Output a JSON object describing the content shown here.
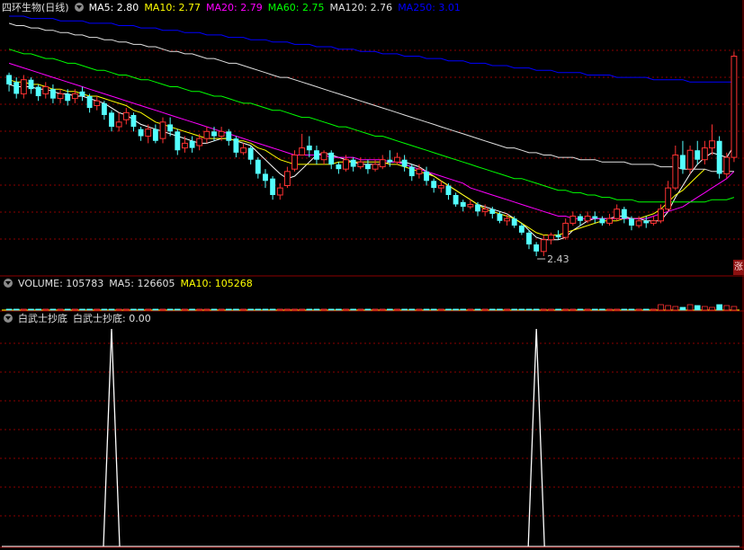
{
  "header_main": {
    "title": "四环生物(日线)",
    "ma5": "MA5: 2.80",
    "ma10": "MA10: 2.77",
    "ma20": "MA20: 2.79",
    "ma60": "MA60: 2.75",
    "ma120": "MA120: 2.76",
    "ma250": "MA250: 3.01"
  },
  "header_volume": {
    "volume": "VOLUME: 105783",
    "ma5": "MA5: 126605",
    "ma10": "MA10: 105268"
  },
  "header_indicator": {
    "name": "白武士抄底",
    "value": "白武士抄底: 0.00"
  },
  "low_marker": "2.43",
  "side_badge": "涨",
  "colors": {
    "up": "#ff3232",
    "down": "#54ffff",
    "ma5": "#ffffff",
    "ma10": "#ffff00",
    "ma20": "#ff00ff",
    "ma60": "#00ff00",
    "ma120": "#e0e0e0",
    "ma250": "#0000ff",
    "grid": "#8b0000"
  },
  "chart_data": [
    {
      "type": "candlestick",
      "title": "四环生物(日线)",
      "ylim": [
        2.35,
        3.45
      ],
      "candles": [
        [
          3.2,
          3.16,
          3.21,
          3.13
        ],
        [
          3.17,
          3.12,
          3.19,
          3.1
        ],
        [
          3.12,
          3.18,
          3.2,
          3.1
        ],
        [
          3.18,
          3.14,
          3.19,
          3.12
        ],
        [
          3.15,
          3.11,
          3.16,
          3.09
        ],
        [
          3.12,
          3.15,
          3.17,
          3.1
        ],
        [
          3.14,
          3.1,
          3.16,
          3.08
        ],
        [
          3.1,
          3.12,
          3.14,
          3.08
        ],
        [
          3.12,
          3.09,
          3.14,
          3.07
        ],
        [
          3.1,
          3.12,
          3.14,
          3.08
        ],
        [
          3.13,
          3.11,
          3.15,
          3.09
        ],
        [
          3.11,
          3.06,
          3.12,
          3.04
        ],
        [
          3.07,
          3.09,
          3.11,
          3.05
        ],
        [
          3.08,
          3.03,
          3.09,
          3.01
        ],
        [
          3.04,
          2.98,
          3.05,
          2.96
        ],
        [
          2.98,
          3.0,
          3.04,
          2.96
        ],
        [
          3.01,
          3.04,
          3.06,
          2.99
        ],
        [
          3.03,
          2.98,
          3.04,
          2.96
        ],
        [
          2.97,
          2.94,
          2.98,
          2.92
        ],
        [
          2.94,
          2.97,
          2.99,
          2.91
        ],
        [
          2.97,
          2.92,
          2.99,
          2.91
        ],
        [
          2.93,
          3.0,
          3.02,
          2.91
        ],
        [
          2.99,
          2.96,
          3.02,
          2.94
        ],
        [
          2.96,
          2.88,
          2.97,
          2.86
        ],
        [
          2.89,
          2.91,
          2.94,
          2.87
        ],
        [
          2.92,
          2.89,
          2.94,
          2.87
        ],
        [
          2.9,
          2.93,
          2.95,
          2.88
        ],
        [
          2.93,
          2.96,
          2.98,
          2.91
        ],
        [
          2.96,
          2.94,
          2.98,
          2.92
        ],
        [
          2.94,
          2.96,
          2.98,
          2.92
        ],
        [
          2.96,
          2.92,
          2.97,
          2.9
        ],
        [
          2.93,
          2.87,
          2.94,
          2.85
        ],
        [
          2.87,
          2.89,
          2.91,
          2.86
        ],
        [
          2.89,
          2.84,
          2.9,
          2.82
        ],
        [
          2.84,
          2.78,
          2.85,
          2.76
        ],
        [
          2.78,
          2.75,
          2.8,
          2.72
        ],
        [
          2.76,
          2.69,
          2.77,
          2.67
        ],
        [
          2.69,
          2.72,
          2.74,
          2.67
        ],
        [
          2.73,
          2.79,
          2.81,
          2.72
        ],
        [
          2.8,
          2.86,
          2.88,
          2.79
        ],
        [
          2.86,
          2.89,
          2.95,
          2.86
        ],
        [
          2.9,
          2.88,
          2.94,
          2.85
        ],
        [
          2.88,
          2.84,
          2.9,
          2.82
        ],
        [
          2.84,
          2.87,
          2.88,
          2.82
        ],
        [
          2.87,
          2.82,
          2.88,
          2.8
        ],
        [
          2.82,
          2.8,
          2.83,
          2.78
        ],
        [
          2.8,
          2.84,
          2.86,
          2.79
        ],
        [
          2.84,
          2.81,
          2.85,
          2.79
        ],
        [
          2.81,
          2.83,
          2.85,
          2.8
        ],
        [
          2.82,
          2.8,
          2.84,
          2.78
        ],
        [
          2.8,
          2.82,
          2.84,
          2.79
        ],
        [
          2.81,
          2.84,
          2.86,
          2.8
        ],
        [
          2.84,
          2.83,
          2.88,
          2.81
        ],
        [
          2.83,
          2.85,
          2.87,
          2.82
        ],
        [
          2.84,
          2.81,
          2.86,
          2.79
        ],
        [
          2.81,
          2.77,
          2.82,
          2.75
        ],
        [
          2.78,
          2.8,
          2.82,
          2.76
        ],
        [
          2.79,
          2.75,
          2.81,
          2.73
        ],
        [
          2.75,
          2.72,
          2.76,
          2.7
        ],
        [
          2.72,
          2.73,
          2.75,
          2.7
        ],
        [
          2.73,
          2.69,
          2.74,
          2.67
        ],
        [
          2.69,
          2.65,
          2.7,
          2.64
        ],
        [
          2.66,
          2.64,
          2.67,
          2.62
        ],
        [
          2.64,
          2.65,
          2.67,
          2.63
        ],
        [
          2.65,
          2.62,
          2.66,
          2.6
        ],
        [
          2.62,
          2.63,
          2.65,
          2.6
        ],
        [
          2.63,
          2.61,
          2.64,
          2.59
        ],
        [
          2.61,
          2.58,
          2.62,
          2.57
        ],
        [
          2.58,
          2.59,
          2.61,
          2.56
        ],
        [
          2.59,
          2.56,
          2.6,
          2.55
        ],
        [
          2.56,
          2.53,
          2.57,
          2.52
        ],
        [
          2.53,
          2.48,
          2.54,
          2.46
        ],
        [
          2.48,
          2.45,
          2.49,
          2.43
        ],
        [
          2.45,
          2.5,
          2.52,
          2.43
        ],
        [
          2.5,
          2.52,
          2.53,
          2.48
        ],
        [
          2.52,
          2.51,
          2.54,
          2.5
        ],
        [
          2.51,
          2.57,
          2.59,
          2.5
        ],
        [
          2.57,
          2.6,
          2.62,
          2.56
        ],
        [
          2.6,
          2.58,
          2.61,
          2.56
        ],
        [
          2.58,
          2.6,
          2.62,
          2.57
        ],
        [
          2.6,
          2.59,
          2.62,
          2.57
        ],
        [
          2.59,
          2.57,
          2.6,
          2.56
        ],
        [
          2.57,
          2.59,
          2.61,
          2.56
        ],
        [
          2.59,
          2.63,
          2.65,
          2.58
        ],
        [
          2.63,
          2.59,
          2.64,
          2.57
        ],
        [
          2.59,
          2.56,
          2.6,
          2.54
        ],
        [
          2.56,
          2.58,
          2.6,
          2.55
        ],
        [
          2.58,
          2.57,
          2.6,
          2.55
        ],
        [
          2.57,
          2.58,
          2.6,
          2.56
        ],
        [
          2.58,
          2.63,
          2.65,
          2.57
        ],
        [
          2.63,
          2.72,
          2.75,
          2.62
        ],
        [
          2.72,
          2.86,
          2.9,
          2.71
        ],
        [
          2.86,
          2.8,
          2.92,
          2.78
        ],
        [
          2.8,
          2.88,
          2.9,
          2.78
        ],
        [
          2.88,
          2.84,
          2.92,
          2.82
        ],
        [
          2.84,
          2.89,
          2.92,
          2.82
        ],
        [
          2.89,
          2.92,
          2.99,
          2.86
        ],
        [
          2.92,
          2.78,
          2.94,
          2.76
        ],
        [
          2.78,
          2.85,
          2.87,
          2.76
        ],
        [
          2.85,
          3.28,
          3.3,
          2.83
        ]
      ],
      "ma": {
        "MA5": [
          3.16,
          3.15,
          3.15,
          3.15,
          3.14,
          3.14,
          3.13,
          3.12,
          3.12,
          3.11,
          3.11,
          3.1,
          3.09,
          3.08,
          3.06,
          3.04,
          3.03,
          3.01,
          2.99,
          2.98,
          2.97,
          2.96,
          2.95,
          2.94,
          2.93,
          2.92,
          2.91,
          2.91,
          2.92,
          2.93,
          2.93,
          2.92,
          2.91,
          2.9,
          2.87,
          2.84,
          2.81,
          2.78,
          2.76,
          2.77,
          2.8,
          2.83,
          2.86,
          2.87,
          2.86,
          2.85,
          2.84,
          2.83,
          2.82,
          2.82,
          2.82,
          2.82,
          2.83,
          2.83,
          2.83,
          2.82,
          2.81,
          2.79,
          2.77,
          2.75,
          2.73,
          2.71,
          2.69,
          2.67,
          2.65,
          2.64,
          2.63,
          2.62,
          2.61,
          2.59,
          2.57,
          2.54,
          2.51,
          2.5,
          2.5,
          2.5,
          2.51,
          2.54,
          2.56,
          2.58,
          2.59,
          2.59,
          2.59,
          2.6,
          2.6,
          2.59,
          2.59,
          2.58,
          2.58,
          2.58,
          2.62,
          2.68,
          2.73,
          2.78,
          2.82,
          2.85,
          2.87,
          2.86,
          2.85,
          2.9
        ],
        "MA10": [
          3.18,
          3.17,
          3.17,
          3.16,
          3.16,
          3.15,
          3.14,
          3.14,
          3.13,
          3.13,
          3.12,
          3.11,
          3.11,
          3.1,
          3.09,
          3.08,
          3.07,
          3.05,
          3.04,
          3.02,
          3.0,
          2.99,
          2.98,
          2.97,
          2.96,
          2.95,
          2.94,
          2.93,
          2.93,
          2.93,
          2.93,
          2.92,
          2.92,
          2.91,
          2.89,
          2.88,
          2.86,
          2.84,
          2.83,
          2.82,
          2.82,
          2.82,
          2.82,
          2.82,
          2.82,
          2.83,
          2.83,
          2.83,
          2.83,
          2.83,
          2.83,
          2.83,
          2.82,
          2.82,
          2.81,
          2.8,
          2.79,
          2.78,
          2.77,
          2.75,
          2.73,
          2.71,
          2.69,
          2.67,
          2.65,
          2.63,
          2.62,
          2.61,
          2.6,
          2.59,
          2.57,
          2.55,
          2.53,
          2.52,
          2.52,
          2.52,
          2.53,
          2.54,
          2.55,
          2.56,
          2.57,
          2.58,
          2.58,
          2.58,
          2.59,
          2.59,
          2.59,
          2.6,
          2.61,
          2.63,
          2.66,
          2.69,
          2.71,
          2.74,
          2.77,
          2.8
        ],
        "MA20": [
          3.25,
          3.24,
          3.23,
          3.22,
          3.21,
          3.2,
          3.19,
          3.18,
          3.17,
          3.16,
          3.15,
          3.14,
          3.13,
          3.12,
          3.11,
          3.1,
          3.09,
          3.08,
          3.07,
          3.06,
          3.05,
          3.04,
          3.03,
          3.02,
          3.01,
          3.0,
          2.99,
          2.98,
          2.97,
          2.96,
          2.95,
          2.94,
          2.93,
          2.92,
          2.91,
          2.9,
          2.89,
          2.88,
          2.87,
          2.86,
          2.86,
          2.86,
          2.86,
          2.86,
          2.85,
          2.85,
          2.85,
          2.85,
          2.84,
          2.84,
          2.84,
          2.84,
          2.83,
          2.83,
          2.82,
          2.81,
          2.8,
          2.79,
          2.78,
          2.77,
          2.76,
          2.75,
          2.74,
          2.72,
          2.71,
          2.7,
          2.69,
          2.68,
          2.67,
          2.66,
          2.65,
          2.64,
          2.63,
          2.62,
          2.61,
          2.6,
          2.6,
          2.59,
          2.59,
          2.59,
          2.59,
          2.59,
          2.59,
          2.59,
          2.59,
          2.59,
          2.59,
          2.59,
          2.6,
          2.61,
          2.62,
          2.63,
          2.64,
          2.66,
          2.68,
          2.7,
          2.72,
          2.74,
          2.76,
          2.79
        ],
        "MA60": [
          3.31,
          3.3,
          3.29,
          3.29,
          3.28,
          3.27,
          3.27,
          3.26,
          3.25,
          3.25,
          3.24,
          3.23,
          3.22,
          3.22,
          3.21,
          3.2,
          3.2,
          3.19,
          3.18,
          3.18,
          3.17,
          3.16,
          3.15,
          3.15,
          3.14,
          3.13,
          3.13,
          3.12,
          3.11,
          3.11,
          3.1,
          3.09,
          3.08,
          3.08,
          3.07,
          3.06,
          3.05,
          3.05,
          3.04,
          3.03,
          3.02,
          3.02,
          3.01,
          3.0,
          2.99,
          2.98,
          2.98,
          2.97,
          2.96,
          2.95,
          2.94,
          2.94,
          2.93,
          2.92,
          2.91,
          2.9,
          2.89,
          2.88,
          2.87,
          2.86,
          2.85,
          2.84,
          2.83,
          2.82,
          2.81,
          2.8,
          2.79,
          2.78,
          2.77,
          2.76,
          2.76,
          2.75,
          2.74,
          2.73,
          2.72,
          2.71,
          2.71,
          2.7,
          2.7,
          2.69,
          2.69,
          2.68,
          2.68,
          2.67,
          2.67,
          2.67,
          2.66,
          2.66,
          2.66,
          2.66,
          2.66,
          2.66,
          2.66,
          2.66,
          2.66,
          2.66,
          2.67,
          2.67,
          2.67,
          2.68
        ],
        "MA120": [
          3.42,
          3.41,
          3.41,
          3.4,
          3.4,
          3.39,
          3.39,
          3.38,
          3.38,
          3.37,
          3.37,
          3.36,
          3.36,
          3.35,
          3.35,
          3.34,
          3.34,
          3.33,
          3.33,
          3.32,
          3.32,
          3.31,
          3.3,
          3.3,
          3.29,
          3.29,
          3.28,
          3.27,
          3.27,
          3.26,
          3.25,
          3.25,
          3.24,
          3.23,
          3.22,
          3.21,
          3.2,
          3.19,
          3.19,
          3.18,
          3.17,
          3.16,
          3.15,
          3.14,
          3.13,
          3.12,
          3.11,
          3.1,
          3.09,
          3.08,
          3.07,
          3.06,
          3.05,
          3.04,
          3.03,
          3.02,
          3.01,
          3.0,
          2.99,
          2.98,
          2.97,
          2.96,
          2.95,
          2.94,
          2.93,
          2.92,
          2.91,
          2.9,
          2.89,
          2.89,
          2.88,
          2.87,
          2.87,
          2.86,
          2.86,
          2.85,
          2.85,
          2.85,
          2.84,
          2.84,
          2.84,
          2.83,
          2.83,
          2.83,
          2.83,
          2.82,
          2.82,
          2.82,
          2.82,
          2.81,
          2.81,
          2.81,
          2.8,
          2.8,
          2.8,
          2.8,
          2.79,
          2.79,
          2.79,
          2.79
        ],
        "MA250": [
          3.45,
          3.45,
          3.45,
          3.44,
          3.44,
          3.44,
          3.44,
          3.43,
          3.43,
          3.43,
          3.43,
          3.42,
          3.42,
          3.42,
          3.42,
          3.41,
          3.41,
          3.41,
          3.4,
          3.4,
          3.4,
          3.39,
          3.39,
          3.39,
          3.38,
          3.38,
          3.38,
          3.37,
          3.37,
          3.37,
          3.36,
          3.36,
          3.36,
          3.35,
          3.35,
          3.35,
          3.34,
          3.34,
          3.34,
          3.33,
          3.33,
          3.33,
          3.32,
          3.32,
          3.32,
          3.31,
          3.31,
          3.31,
          3.3,
          3.3,
          3.3,
          3.29,
          3.29,
          3.29,
          3.28,
          3.28,
          3.28,
          3.27,
          3.27,
          3.27,
          3.26,
          3.26,
          3.26,
          3.25,
          3.25,
          3.25,
          3.24,
          3.24,
          3.24,
          3.23,
          3.23,
          3.23,
          3.22,
          3.22,
          3.22,
          3.21,
          3.21,
          3.21,
          3.21,
          3.2,
          3.2,
          3.2,
          3.2,
          3.19,
          3.19,
          3.19,
          3.19,
          3.19,
          3.18,
          3.18,
          3.18,
          3.18,
          3.18,
          3.17,
          3.17,
          3.17,
          3.17,
          3.17,
          3.17,
          3.17
        ]
      }
    },
    {
      "type": "bar",
      "title": "VOLUME",
      "values_note": "mostly flat small bars; last bars slightly larger"
    },
    {
      "type": "line",
      "title": "白武士抄底",
      "spikes_at_index": [
        14,
        72
      ],
      "ylim": [
        0,
        1
      ]
    }
  ]
}
